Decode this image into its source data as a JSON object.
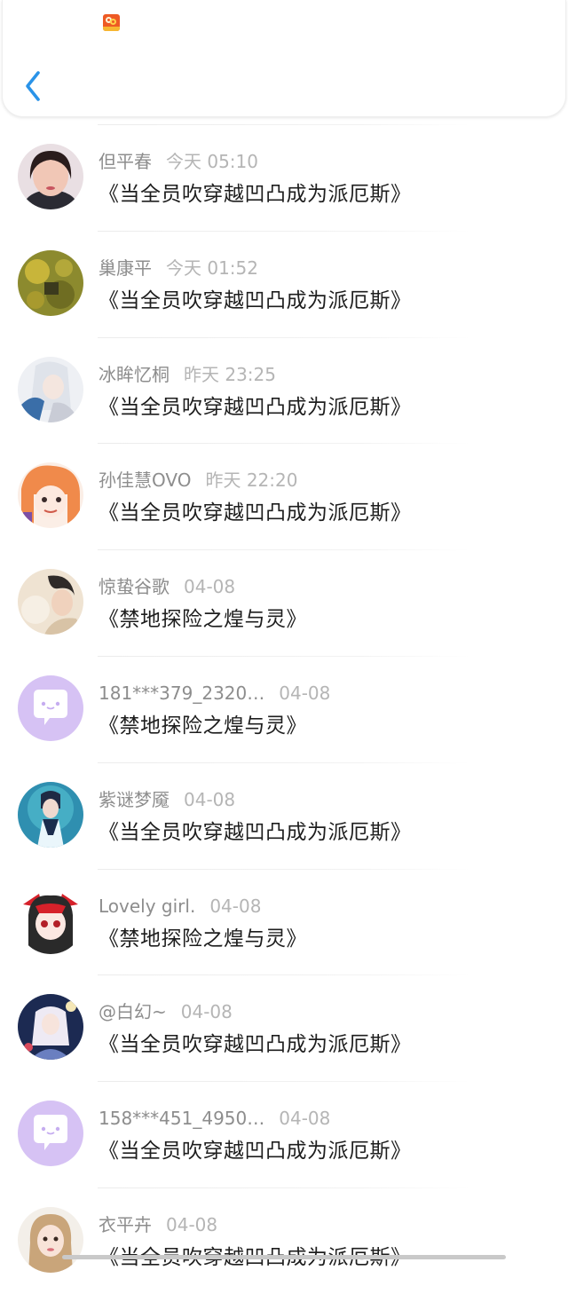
{
  "header": {
    "logo_icon": "app-logo-icon",
    "back_icon": "chevron-left-icon",
    "accent_color": "#2a93e8"
  },
  "messages": [
    {
      "name": "但平春",
      "time": "今天 05:10",
      "book": "《当全员吹穿越凹凸成为派厄斯》",
      "avatar": "avatar-photo-woman"
    },
    {
      "name": "巢康平",
      "time": "今天 01:52",
      "book": "《当全员吹穿越凹凸成为派厄斯》",
      "avatar": "avatar-sunflower"
    },
    {
      "name": "冰眸忆桐",
      "time": "昨天 23:25",
      "book": "《当全员吹穿越凹凸成为派厄斯》",
      "avatar": "avatar-anime-white-hair"
    },
    {
      "name": "孙佳慧OVO",
      "time": "昨天 22:20",
      "book": "《当全员吹穿越凹凸成为派厄斯》",
      "avatar": "avatar-anime-orange-hair"
    },
    {
      "name": "惊蛰谷歌",
      "time": "04-08",
      "book": "《禁地探险之煌与灵》",
      "avatar": "avatar-illustration-boy"
    },
    {
      "name": "181***379_2320…",
      "time": "04-08",
      "book": "《禁地探险之煌与灵》",
      "avatar": "default-chat-bubble-avatar"
    },
    {
      "name": "紫谜梦魇",
      "time": "04-08",
      "book": "《当全员吹穿越凹凸成为派厄斯》",
      "avatar": "avatar-anime-teal"
    },
    {
      "name": "Lovely girl.",
      "time": "04-08",
      "book": "《禁地探险之煌与灵》",
      "avatar": "avatar-red-hood-girl"
    },
    {
      "name": "@白幻~",
      "time": "04-08",
      "book": "《当全员吹穿越凹凸成为派厄斯》",
      "avatar": "avatar-anime-night"
    },
    {
      "name": "158***451_4950…",
      "time": "04-08",
      "book": "《当全员吹穿越凹凸成为派厄斯》",
      "avatar": "default-chat-bubble-avatar"
    },
    {
      "name": "衣平卉",
      "time": "04-08",
      "book": "《当全员吹穿越凹凸成为派厄斯》",
      "avatar": "avatar-photo-girl"
    }
  ]
}
